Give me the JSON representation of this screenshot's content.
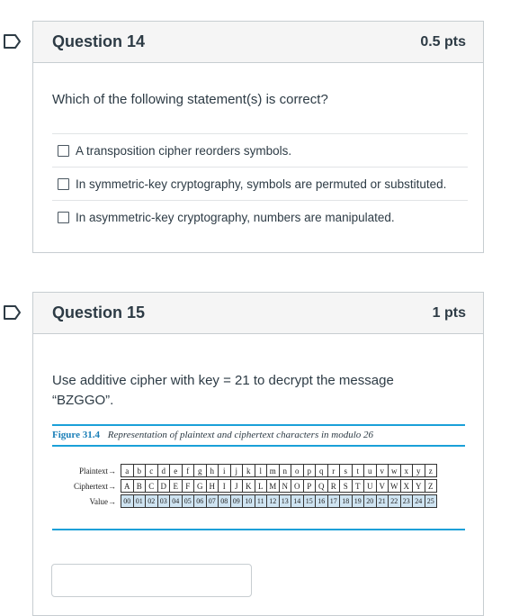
{
  "questions": [
    {
      "title": "Question 14",
      "points": "0.5 pts",
      "prompt": "Which of the following statement(s) is correct?",
      "options": [
        "A transposition cipher reorders symbols.",
        "In symmetric-key cryptography, symbols are permuted or substituted.",
        "In asymmetric-key cryptography, numbers are manipulated."
      ]
    },
    {
      "title": "Question 15",
      "points": "1 pts",
      "prompt_line1": "Use additive cipher with key = 21 to decrypt the message",
      "prompt_line2": "“BZGGO”.",
      "figure": {
        "number": "Figure 31.4",
        "caption": "Representation of plaintext and ciphertext characters in modulo 26",
        "row_labels": [
          "Plaintext",
          "Ciphertext",
          "Value"
        ],
        "plaintext": [
          "a",
          "b",
          "c",
          "d",
          "e",
          "f",
          "g",
          "h",
          "i",
          "j",
          "k",
          "l",
          "m",
          "n",
          "o",
          "p",
          "q",
          "r",
          "s",
          "t",
          "u",
          "v",
          "w",
          "x",
          "y",
          "z"
        ],
        "ciphertext": [
          "A",
          "B",
          "C",
          "D",
          "E",
          "F",
          "G",
          "H",
          "I",
          "J",
          "K",
          "L",
          "M",
          "N",
          "O",
          "P",
          "Q",
          "R",
          "S",
          "T",
          "U",
          "V",
          "W",
          "X",
          "Y",
          "Z"
        ],
        "values": [
          "00",
          "01",
          "02",
          "03",
          "04",
          "05",
          "06",
          "07",
          "08",
          "09",
          "10",
          "11",
          "12",
          "13",
          "14",
          "15",
          "16",
          "17",
          "18",
          "19",
          "20",
          "21",
          "22",
          "23",
          "24",
          "25"
        ]
      },
      "answer_value": ""
    }
  ],
  "icons": {
    "flag": "bookmark-flag-icon",
    "checkbox": "checkbox-empty-icon",
    "arrow": "arrow-right-icon"
  },
  "colors": {
    "accent": "#1aa0d8",
    "flag": "#2d3b45",
    "header_bg": "#f5f5f5",
    "value_cells": "#cfe4f2"
  }
}
